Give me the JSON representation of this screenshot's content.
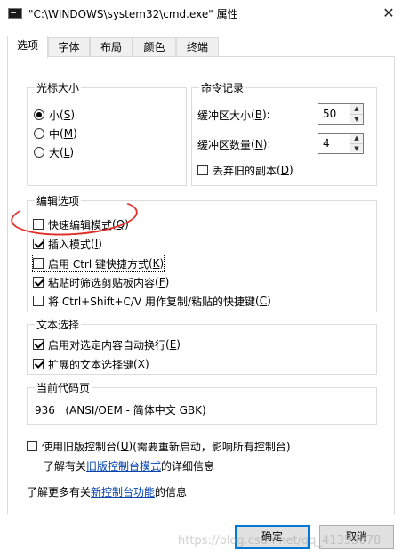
{
  "window": {
    "title": "\"C:\\WINDOWS\\system32\\cmd.exe\" 属性",
    "close_glyph": "✕",
    "icon": "console-icon"
  },
  "tabs": [
    "选项",
    "字体",
    "布局",
    "颜色",
    "终端"
  ],
  "cursor_size": {
    "label": "光标大小",
    "options": [
      {
        "text": "小",
        "key": "S",
        "selected": true
      },
      {
        "text": "中",
        "key": "M",
        "selected": false
      },
      {
        "text": "大",
        "key": "L",
        "selected": false
      }
    ]
  },
  "command_history": {
    "label": "命令记录",
    "buffer_size": {
      "text": "缓冲区大小",
      "key": "B",
      "value": "50"
    },
    "buffer_count": {
      "text": "缓冲区数量",
      "key": "N",
      "value": "4"
    },
    "discard_duplicates": {
      "text": "丢弃旧的副本",
      "key": "D",
      "checked": false
    }
  },
  "edit_options": {
    "label": "编辑选项",
    "items": [
      {
        "text": "快速编辑模式",
        "key": "Q",
        "checked": false
      },
      {
        "text": "插入模式",
        "key": "I",
        "checked": true
      },
      {
        "text": "启用 Ctrl 键快捷方式",
        "key": "K",
        "checked": false
      },
      {
        "text": "粘贴时筛选剪贴板内容",
        "key": "F",
        "checked": true
      },
      {
        "text": "将 Ctrl+Shift+C/V 用作复制/粘贴的快捷键",
        "key": "C",
        "checked": false
      }
    ]
  },
  "text_selection": {
    "label": "文本选择",
    "items": [
      {
        "text": "启用对选定内容自动换行",
        "key": "E",
        "checked": true
      },
      {
        "text": "扩展的文本选择键",
        "key": "X",
        "checked": true
      }
    ]
  },
  "codepage": {
    "label": "当前代码页",
    "value": "936   (ANSI/OEM - 简体中文 GBK)"
  },
  "legacy": {
    "text": "使用旧版控制台",
    "key": "U",
    "suffix": "(需要重新启动，影响所有控制台)",
    "checked": false,
    "info_prefix": "了解有关",
    "info_link": "旧版控制台模式",
    "info_suffix": "的详细信息"
  },
  "more_info": {
    "prefix": "了解更多有关",
    "link": "新控制台功能",
    "suffix": "的信息"
  },
  "buttons": {
    "ok": "确定",
    "cancel": "取消"
  },
  "watermark": "https://blog.csdn.net/qq_41353678",
  "colors": {
    "accent": "#0078d7",
    "link": "#0645ad",
    "annotation": "#e0312b"
  }
}
